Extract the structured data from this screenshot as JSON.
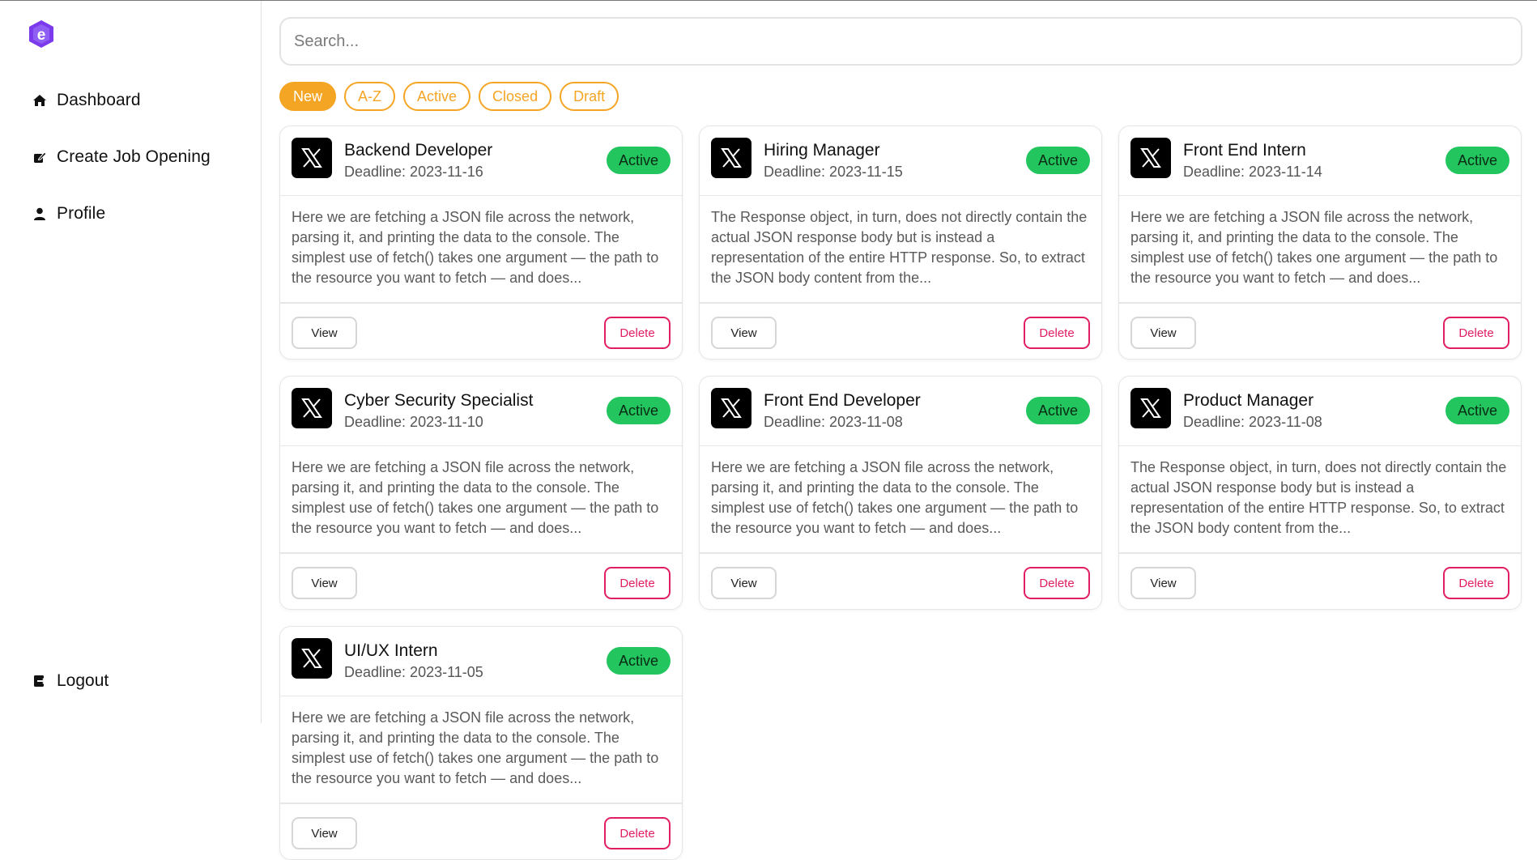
{
  "sidebar": {
    "logo_icon": "e-logo-icon",
    "brand_color": "#7c3aed",
    "items": [
      {
        "label": "Dashboard",
        "icon": "home-icon"
      },
      {
        "label": "Create Job Opening",
        "icon": "edit-icon"
      },
      {
        "label": "Profile",
        "icon": "user-icon"
      }
    ],
    "logout": {
      "label": "Logout",
      "icon": "logout-icon"
    }
  },
  "search": {
    "placeholder": "Search..."
  },
  "filters": [
    {
      "label": "New",
      "selected": true
    },
    {
      "label": "A-Z",
      "selected": false
    },
    {
      "label": "Active",
      "selected": false
    },
    {
      "label": "Closed",
      "selected": false
    },
    {
      "label": "Draft",
      "selected": false
    }
  ],
  "colors": {
    "accent": "#f5a524",
    "status_active": "#22c55e",
    "danger": "#e11d63"
  },
  "jobs": [
    {
      "title": "Backend Developer",
      "deadline": "Deadline: 2023-11-16",
      "status": "Active",
      "company_icon": "x-logo-icon",
      "description": "Here we are fetching a JSON file across the network, parsing it, and printing the data to the console. The simplest use of fetch() takes one argument — the path to the resource you want to fetch — and does...",
      "view_label": "View",
      "delete_label": "Delete"
    },
    {
      "title": "Hiring Manager",
      "deadline": "Deadline: 2023-11-15",
      "status": "Active",
      "company_icon": "x-logo-icon",
      "description": "The Response object, in turn, does not directly contain the actual JSON response body but is instead a representation of the entire HTTP response. So, to extract the JSON body content from the...",
      "view_label": "View",
      "delete_label": "Delete"
    },
    {
      "title": "Front End Intern",
      "deadline": "Deadline: 2023-11-14",
      "status": "Active",
      "company_icon": "x-logo-icon",
      "description": "Here we are fetching a JSON file across the network, parsing it, and printing the data to the console. The simplest use of fetch() takes one argument — the path to the resource you want to fetch — and does...",
      "view_label": "View",
      "delete_label": "Delete"
    },
    {
      "title": "Cyber Security Specialist",
      "deadline": "Deadline: 2023-11-10",
      "status": "Active",
      "company_icon": "x-logo-icon",
      "description": "Here we are fetching a JSON file across the network, parsing it, and printing the data to the console. The simplest use of fetch() takes one argument — the path to the resource you want to fetch — and does...",
      "view_label": "View",
      "delete_label": "Delete"
    },
    {
      "title": "Front End Developer",
      "deadline": "Deadline: 2023-11-08",
      "status": "Active",
      "company_icon": "x-logo-icon",
      "description": "Here we are fetching a JSON file across the network, parsing it, and printing the data to the console. The simplest use of fetch() takes one argument — the path to the resource you want to fetch — and does...",
      "view_label": "View",
      "delete_label": "Delete"
    },
    {
      "title": "Product Manager",
      "deadline": "Deadline: 2023-11-08",
      "status": "Active",
      "company_icon": "x-logo-icon",
      "description": "The Response object, in turn, does not directly contain the actual JSON response body but is instead a representation of the entire HTTP response. So, to extract the JSON body content from the...",
      "view_label": "View",
      "delete_label": "Delete"
    },
    {
      "title": "UI/UX Intern",
      "deadline": "Deadline: 2023-11-05",
      "status": "Active",
      "company_icon": "x-logo-icon",
      "description": "Here we are fetching a JSON file across the network, parsing it, and printing the data to the console. The simplest use of fetch() takes one argument — the path to the resource you want to fetch — and does...",
      "view_label": "View",
      "delete_label": "Delete"
    }
  ]
}
